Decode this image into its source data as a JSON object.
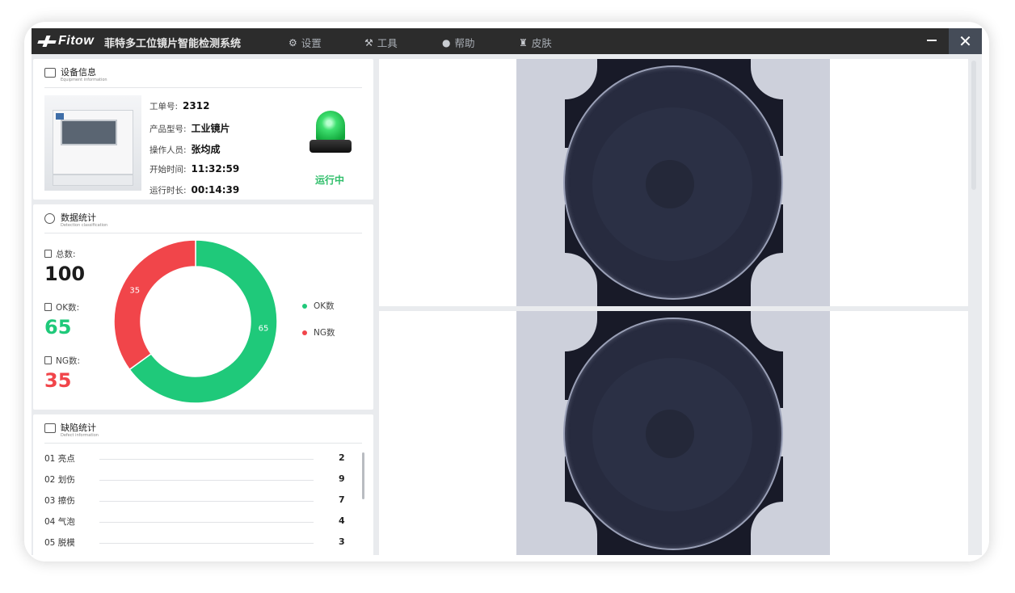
{
  "titlebar": {
    "logo_text": "Fitow",
    "app_title": "菲特多工位镜片智能检测系统",
    "menu": [
      {
        "icon": "gear-icon",
        "glyph": "⚙",
        "label": "设置"
      },
      {
        "icon": "wrench-icon",
        "glyph": "⚒",
        "label": "工具"
      },
      {
        "icon": "help-icon",
        "glyph": "●",
        "label": "帮助"
      },
      {
        "icon": "shirt-icon",
        "glyph": "♜",
        "label": "皮肤"
      }
    ],
    "close_glyph": "✕"
  },
  "equipment": {
    "title_cn": "设备信息",
    "title_en": "Equipment information",
    "fields": [
      {
        "label": "工单号:",
        "value": "2312"
      },
      {
        "label": "产品型号:",
        "value": "工业镜片"
      },
      {
        "label": "操作人员:",
        "value": "张均成"
      },
      {
        "label": "开始时间:",
        "value": "11:32:59"
      },
      {
        "label": "运行时长:",
        "value": "00:14:39"
      }
    ],
    "status_text": "运行中",
    "status_color": "#2fbe6a"
  },
  "stats": {
    "title_cn": "数据统计",
    "title_en": "Detection classification",
    "total_label": "总数:",
    "total_value": "100",
    "ok_label": "OK数:",
    "ok_value": "65",
    "ng_label": "NG数:",
    "ng_value": "35",
    "ok_color": "#1fc97a",
    "ng_color": "#f1454a",
    "legend_ok": "OK数",
    "legend_ng": "NG数"
  },
  "chart_data": {
    "type": "pie",
    "donut": true,
    "categories": [
      "OK数",
      "NG数"
    ],
    "values": [
      65,
      35
    ],
    "colors": [
      "#1fc97a",
      "#f1454a"
    ],
    "data_labels": [
      "65",
      "35"
    ],
    "legend_position": "right"
  },
  "defects": {
    "title_cn": "缺陷统计",
    "title_en": "Defect information",
    "items": [
      {
        "name": "01 亮点",
        "count": "2"
      },
      {
        "name": "02 划伤",
        "count": "9"
      },
      {
        "name": "03 擦伤",
        "count": "7"
      },
      {
        "name": "04 气泡",
        "count": "4"
      },
      {
        "name": "05 脱模",
        "count": "3"
      }
    ]
  }
}
